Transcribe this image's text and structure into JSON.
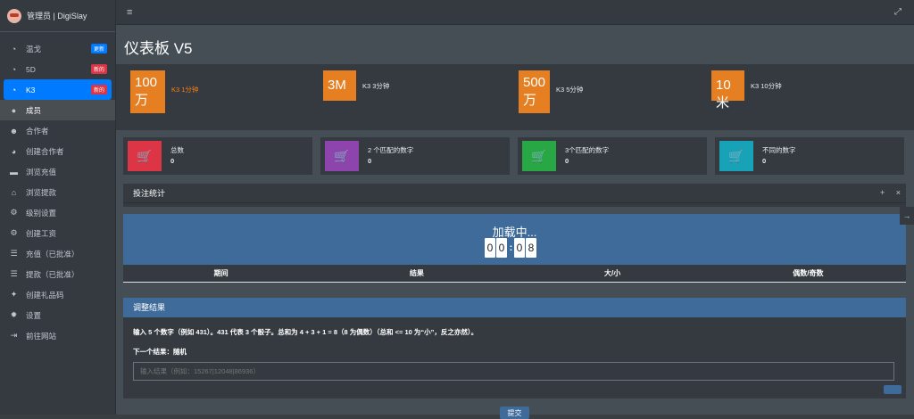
{
  "brand": {
    "title": "管理员 | DigiSlay"
  },
  "sidebar": {
    "items": [
      {
        "label": "温戈",
        "icon": "dashboard-icon",
        "glyph": "◔",
        "badge": "更新",
        "badge_color": "blue"
      },
      {
        "label": "5D",
        "icon": "dashboard-icon",
        "glyph": "◔",
        "badge": "新的",
        "badge_color": "red"
      },
      {
        "label": "K3",
        "icon": "dashboard-icon",
        "glyph": "◔",
        "badge": "新的",
        "badge_color": "red",
        "active": true
      },
      {
        "label": "成员",
        "icon": "user-circle-icon",
        "glyph": "●"
      },
      {
        "label": "合作者",
        "icon": "users-icon",
        "glyph": "☻"
      },
      {
        "label": "创建合作者",
        "icon": "pie-chart-icon",
        "glyph": "◕"
      },
      {
        "label": "浏览充值",
        "icon": "credit-card-icon",
        "glyph": "▬"
      },
      {
        "label": "浏览提款",
        "icon": "bank-icon",
        "glyph": "⌂"
      },
      {
        "label": "级别设置",
        "icon": "cogs-icon",
        "glyph": "⚙"
      },
      {
        "label": "创建工资",
        "icon": "cogs-icon",
        "glyph": "⚙"
      },
      {
        "label": "充值（已批准）",
        "icon": "list-icon",
        "glyph": "☰"
      },
      {
        "label": "提款（已批准）",
        "icon": "list-icon",
        "glyph": "☰"
      },
      {
        "label": "创建礼品码",
        "icon": "gift-icon",
        "glyph": "✦"
      },
      {
        "label": "设置",
        "icon": "gear-icon",
        "glyph": "✹"
      },
      {
        "label": "前往网站",
        "icon": "sign-out-icon",
        "glyph": "⇥"
      }
    ]
  },
  "topbar": {
    "menu_glyph": "≡",
    "expand_glyph": "⤢"
  },
  "page": {
    "title": "仪表板 V5"
  },
  "games": [
    {
      "num": "100\n万",
      "label": "K3 1分钟",
      "highlight": true
    },
    {
      "num": "3M",
      "label": "K3 3分钟"
    },
    {
      "num": "500\n万",
      "label": "K3 5分钟"
    },
    {
      "num": "10米",
      "label": "K3 10分钟"
    }
  ],
  "stats": [
    {
      "label": "总数",
      "value": "0",
      "color": "#dc3545"
    },
    {
      "label": "2 个匹配的数字",
      "value": "0",
      "color": "#8e44ad"
    },
    {
      "label": "3个匹配的数字",
      "value": "0",
      "color": "#28a745"
    },
    {
      "label": "不同的数字",
      "value": "0",
      "color": "#17a2b8"
    }
  ],
  "bet_panel": {
    "title": "投注统计",
    "add_glyph": "+",
    "close_glyph": "×"
  },
  "loader": {
    "text": "加载中...",
    "digits": [
      "0",
      "0",
      "0",
      "8"
    ]
  },
  "table": {
    "headers": [
      "期间",
      "结果",
      "大/小",
      "偶数/奇数"
    ]
  },
  "adjust": {
    "title": "调整结果",
    "instructions": "输入 5 个数字（例如 431）。431 代表 3 个骰子。总和为 4 + 3 + 1 = 8（8 为偶数）（总和 <= 10 为“小”，反之亦然）。",
    "next_result": "下一个结果：随机",
    "placeholder": "输入结果（例如：15267|12048|86936）",
    "submit_label": "提交"
  },
  "side_arrow": "→"
}
